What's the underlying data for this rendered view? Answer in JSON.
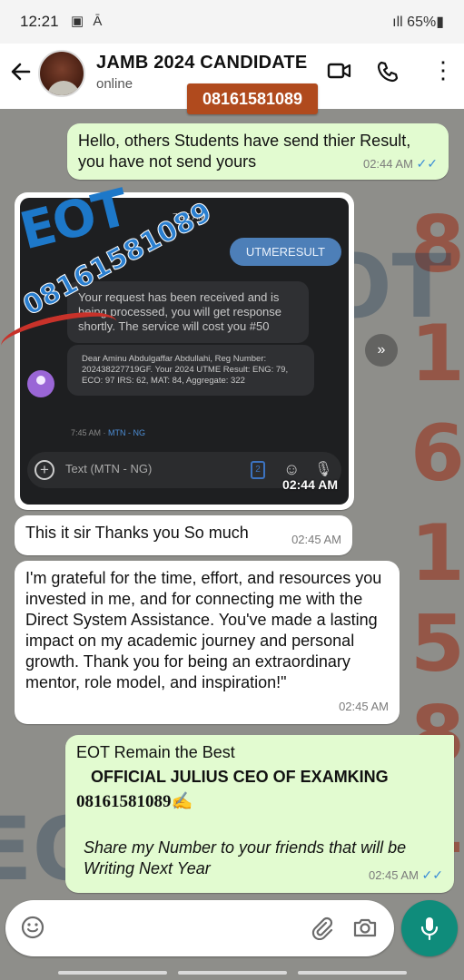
{
  "status_bar": {
    "time": "12:21",
    "icons": "▣ Ā",
    "signal": "ıll",
    "battery": "65%▮"
  },
  "header": {
    "back_icon": "arrow-left",
    "contact_name": "JAMB 2024 CANDIDATE",
    "contact_status": "online",
    "phone_badge": "08161581089"
  },
  "messages": [
    {
      "type": "out",
      "text": "Hello, others Students have send thier Result, you have not send yours",
      "time": "02:44 AM"
    },
    {
      "type": "image",
      "time": "02:44 AM",
      "screenshot": {
        "time": "7:45 AM",
        "sent": "UTMERESULT",
        "recv1": "Your request has been received and is being processed, you will get response shortly. The service will cost you #50",
        "recv2": "Dear Aminu Abdulgaffar Abdullahi, Reg Number: 202438227719GF. Your 2024 UTME Result: ENG: 79, ECO: 97 IRS: 62, MAT: 84, Aggregate: 322",
        "carrier_time": "7:45 AM · ",
        "carrier": "MTN - NG",
        "input_placeholder": "Text (MTN - NG)",
        "sim": "2"
      },
      "logo_text": "EOT",
      "logo_number": "08161581089"
    },
    {
      "type": "in",
      "text": "This it sir Thanks you So much",
      "time": "02:45 AM"
    },
    {
      "type": "in",
      "text": "I'm grateful for the time, effort, and resources you invested in me, and for connecting me with the Direct System Assistance. You've made a lasting impact on my academic journey and personal growth. Thank you for being an extraordinary mentor, role model, and inspiration!\"",
      "time": "02:45 AM"
    },
    {
      "type": "out",
      "line1": "EOT  Remain the Best",
      "line2": "OFFICIAL JULIUS CEO OF EXAMKING",
      "line3": "08161581089✍️",
      "line4": "Share my Number to your friends that will be Writing Next Year",
      "time": "02:45 AM"
    }
  ],
  "input": {
    "placeholder": ""
  },
  "colors": {
    "out_bubble": "#e2fbd0",
    "in_bubble": "#ffffff",
    "accent": "#0f8c7b",
    "read_tick": "#3b8ed6",
    "badge": "#b04a1d"
  }
}
